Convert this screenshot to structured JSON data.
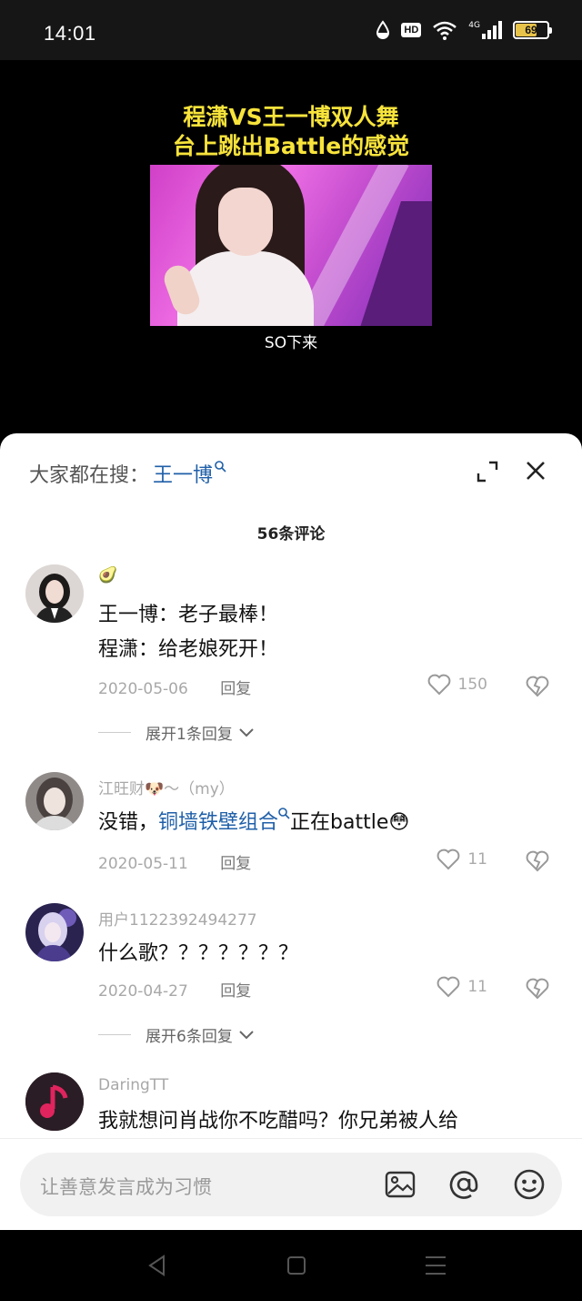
{
  "status_bar": {
    "time": "14:01",
    "network": "4G",
    "hd": "HD",
    "battery": "69",
    "battery_level": 0.69,
    "battery_color": "#e8c34a"
  },
  "video": {
    "title_line1": "程潇VS王一博双人舞",
    "title_line2": "台上跳出Battle的感觉",
    "caption": "SO下来"
  },
  "comments_panel": {
    "search_prefix": "大家都在搜：",
    "search_keyword": "王一博",
    "count_label": "56条评论",
    "accent_color": "#1f5fa8"
  },
  "comments": [
    {
      "username": "🥑",
      "text_line1": "王一博：老子最棒！",
      "text_line2": "程潇：给老娘死开！",
      "date": "2020-05-06",
      "reply_label": "回复",
      "likes": "150",
      "expand_label": "展开1条回复"
    },
    {
      "username": "江旺财🐶～（my）",
      "text_before": "没错，",
      "text_link": "铜墙铁壁组合",
      "text_after": "正在battle",
      "emoji": "😳",
      "date": "2020-05-11",
      "reply_label": "回复",
      "likes": "11"
    },
    {
      "username": "用户1122392494277",
      "text_line1": "什么歌？？？？？？？",
      "date": "2020-04-27",
      "reply_label": "回复",
      "likes": "11",
      "expand_label": "展开6条回复"
    },
    {
      "username": "DaringTT",
      "text_line1": "我就想问肖战你不吃醋吗？你兄弟被人给"
    }
  ],
  "input_bar": {
    "placeholder": "让善意发言成为习惯"
  }
}
